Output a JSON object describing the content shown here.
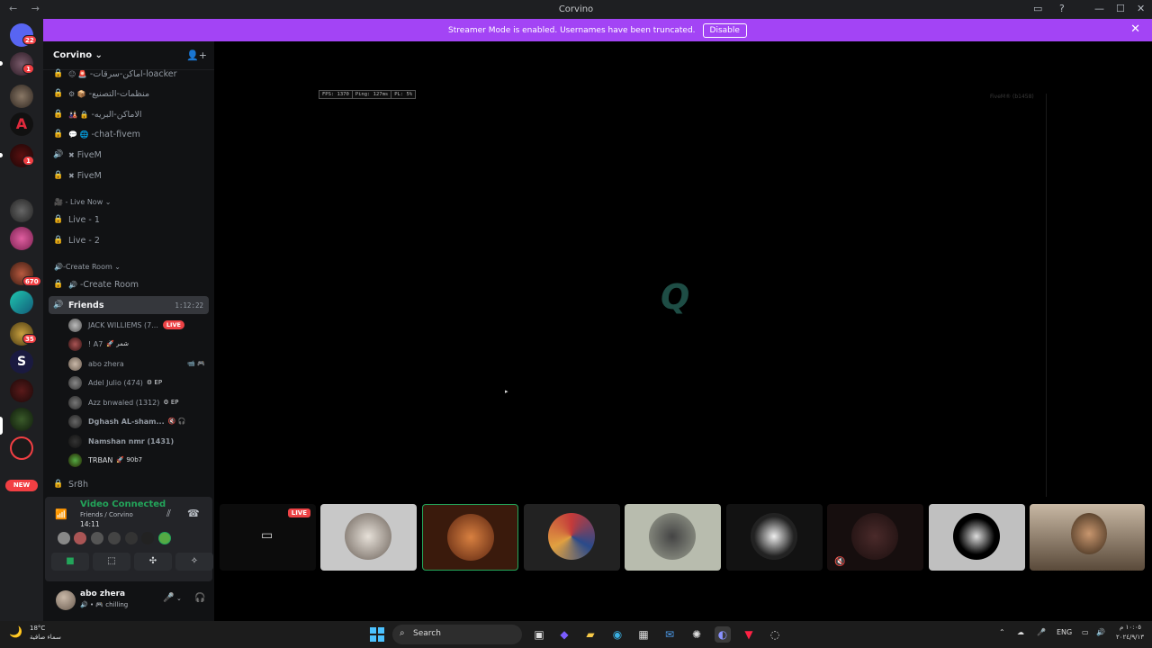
{
  "window": {
    "title": "Corvino",
    "controls": [
      "—",
      "☐",
      "✕"
    ]
  },
  "banner": {
    "text": "Streamer Mode is enabled. Usernames have been truncated.",
    "disable_label": "Disable"
  },
  "servers": {
    "badges": [
      "22",
      "1",
      "1",
      "670",
      "35"
    ],
    "new_label": "NEW"
  },
  "server": {
    "name": "Corvino"
  },
  "channels": [
    {
      "name": "-اماكن-سرقات-loacker",
      "emoji": "😐 🚨"
    },
    {
      "name": "-منظمات-التصنيع",
      "emoji": "⚙ 📦"
    },
    {
      "name": "-الاماكن-البريه",
      "emoji": "🎎 🔒"
    },
    {
      "name": "-chat-fivem",
      "emoji": "💬 🌐"
    },
    {
      "name": "FiveM",
      "emoji": "✖"
    },
    {
      "name": "FiveM",
      "emoji": "✖"
    }
  ],
  "categories": {
    "live_now": "- Live Now",
    "create_room": "-Create Room"
  },
  "live_channels": [
    {
      "name": "Live - 1"
    },
    {
      "name": "Live - 2"
    }
  ],
  "create_room_channel": {
    "name": "-Create Room"
  },
  "voice_channel": {
    "name": "Friends",
    "timer": "1:12:22"
  },
  "voice_users": [
    {
      "name": "JACK WILLIEMS (7...",
      "tag": "",
      "live": "LIVE"
    },
    {
      "name": "! A7",
      "tag": "🚀 شمر"
    },
    {
      "name": "abo zhera",
      "tag": ""
    },
    {
      "name": "Adel Julio (474)",
      "tag": "⚙ EP"
    },
    {
      "name": "Azz bnwaled (1312)",
      "tag": "⚙ EP"
    },
    {
      "name": "Dghash AL-sham...",
      "tag": ""
    },
    {
      "name": "Namshan nmr (1431)",
      "tag": ""
    },
    {
      "name": "TRBAN",
      "tag": "🚀 90b7"
    }
  ],
  "extra_channel": {
    "name": "Sr8h"
  },
  "voice_panel": {
    "status": "Video Connected",
    "subtitle": "Friends / Corvino",
    "time": "14:11"
  },
  "user": {
    "name": "abo zhera",
    "status": "chilling"
  },
  "stage": {
    "stats": [
      "FPS: 1370",
      "Ping: 127ms",
      "PL: 5%"
    ],
    "corner_tag": "FiveM® (b1458)",
    "tile_live_label": "LIVE"
  },
  "taskbar": {
    "temperature": "18°C",
    "weather": "سماء صافية",
    "search_placeholder": "Search",
    "language": "ENG",
    "time": "١٠:٠٥ م",
    "date": "٢٠٢٤/٩/١٣"
  },
  "colors": {
    "banner": "#a344f5",
    "live": "#ed4245",
    "connected": "#23a55a",
    "accent": "#4cc2ff"
  }
}
